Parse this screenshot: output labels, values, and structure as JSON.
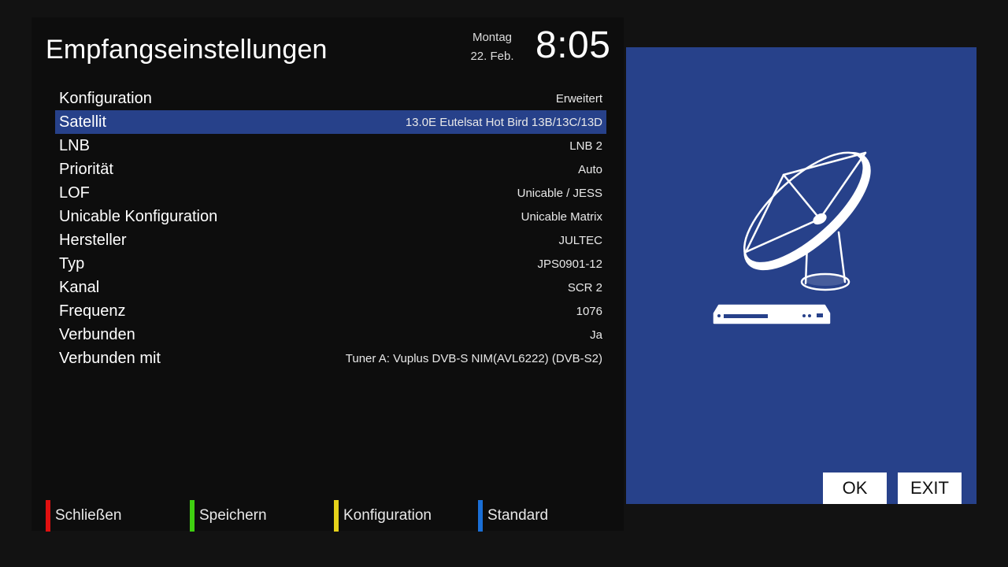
{
  "header": {
    "title": "Empfangseinstellungen",
    "day": "Montag",
    "date": "22. Feb.",
    "time": "8:05"
  },
  "settings": [
    {
      "label": "Konfiguration",
      "value": "Erweitert"
    },
    {
      "label": "Satellit",
      "value": "13.0E Eutelsat Hot Bird 13B/13C/13D"
    },
    {
      "label": "LNB",
      "value": "LNB 2"
    },
    {
      "label": "Priorität",
      "value": "Auto"
    },
    {
      "label": "LOF",
      "value": "Unicable / JESS"
    },
    {
      "label": "Unicable Konfiguration",
      "value": "Unicable Matrix"
    },
    {
      "label": "Hersteller",
      "value": "JULTEC"
    },
    {
      "label": "Typ",
      "value": "JPS0901-12"
    },
    {
      "label": "Kanal",
      "value": "SCR 2"
    },
    {
      "label": "Frequenz",
      "value": "1076"
    },
    {
      "label": "Verbunden",
      "value": "Ja"
    },
    {
      "label": "Verbunden mit",
      "value": "Tuner A: Vuplus DVB-S NIM(AVL6222) (DVB-S2)"
    }
  ],
  "selected_index": 1,
  "color_buttons": {
    "red": {
      "label": "Schließen",
      "color": "#e01010"
    },
    "green": {
      "label": "Speichern",
      "color": "#3fcf10"
    },
    "yellow": {
      "label": "Konfiguration",
      "color": "#e6d21a"
    },
    "blue": {
      "label": "Standard",
      "color": "#1a6fd6"
    }
  },
  "preview": {
    "icon": "satellite-dish-receiver-icon",
    "ok_label": "OK",
    "exit_label": "EXIT"
  },
  "colors": {
    "accent": "#27418a",
    "background": "#121212"
  }
}
